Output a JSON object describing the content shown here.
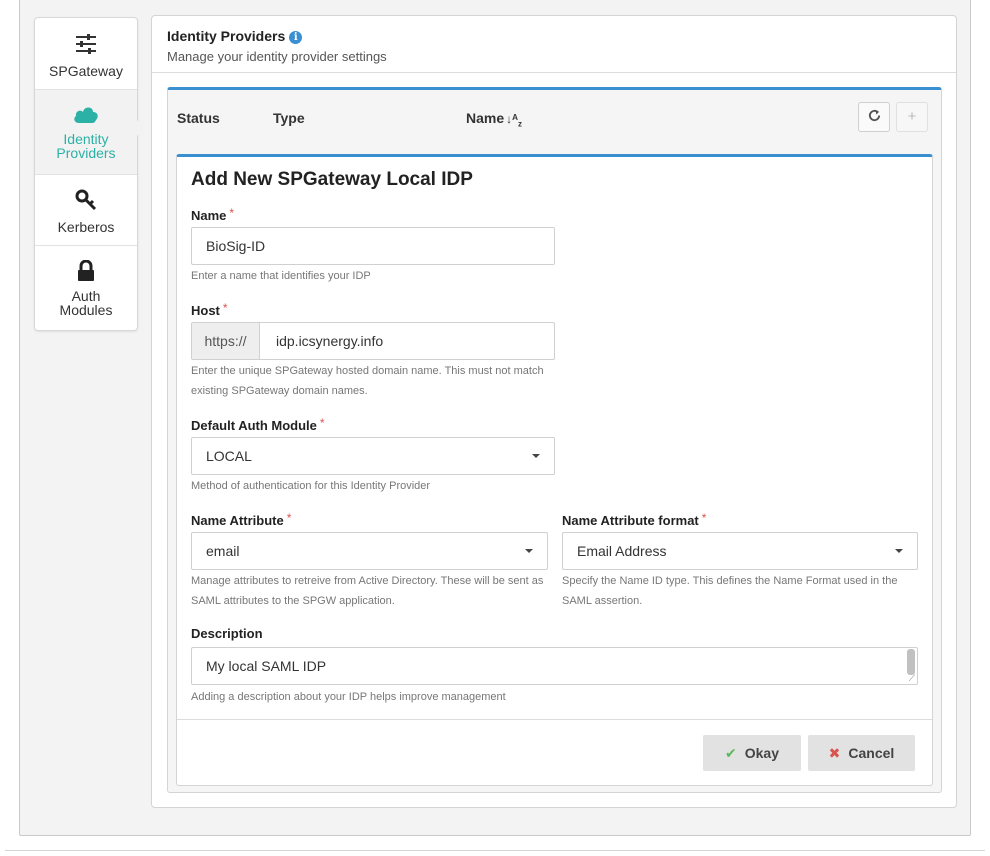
{
  "sidebar": {
    "items": [
      {
        "label": "SPGateway",
        "icon": "sliders-icon",
        "active": false
      },
      {
        "label": "Identity Providers",
        "icon": "cloud-icon",
        "active": true
      },
      {
        "label": "Kerberos",
        "icon": "key-icon",
        "active": false
      },
      {
        "label": "Auth Modules",
        "icon": "lock-icon",
        "active": false
      }
    ]
  },
  "main": {
    "title": "Identity Providers",
    "subtitle": "Manage your identity provider settings"
  },
  "grid": {
    "columns": [
      "Status",
      "Type",
      "Name"
    ],
    "sort_icon": "↓ᴬ₂",
    "refresh_icon": "refresh-icon",
    "add_icon": "plus-icon"
  },
  "form": {
    "title": "Add New SPGateway Local IDP",
    "name": {
      "label": "Name",
      "value": "BioSig-ID",
      "help": "Enter a name that identifies your IDP"
    },
    "host": {
      "label": "Host",
      "prefix": "https://",
      "value": "idp.icsynergy.info",
      "help_line1": "Enter the unique SPGateway hosted domain name. This must not match",
      "help_line2": "existing SPGateway domain names."
    },
    "auth_module": {
      "label": "Default Auth Module",
      "value": "LOCAL",
      "help": "Method of authentication for this Identity Provider"
    },
    "name_attr": {
      "label": "Name Attribute",
      "value": "email",
      "help_line1": "Manage attributes to retreive from Active Directory. These will be sent as",
      "help_line2": "SAML attributes to the SPGW application."
    },
    "name_attr_format": {
      "label": "Name Attribute format",
      "value": "Email Address",
      "help_line1": "Specify the Name ID type. This defines the Name Format used in the",
      "help_line2": "SAML assertion."
    },
    "description": {
      "label": "Description",
      "value": "My local SAML IDP",
      "help": "Adding a description about your IDP helps improve management"
    },
    "required_mark": "*",
    "okay_label": "Okay",
    "cancel_label": "Cancel"
  },
  "colors": {
    "accent": "#2cb1a6",
    "primary_border": "#3a8fd0",
    "required": "#d9534f",
    "ok": "#5cb85c"
  }
}
